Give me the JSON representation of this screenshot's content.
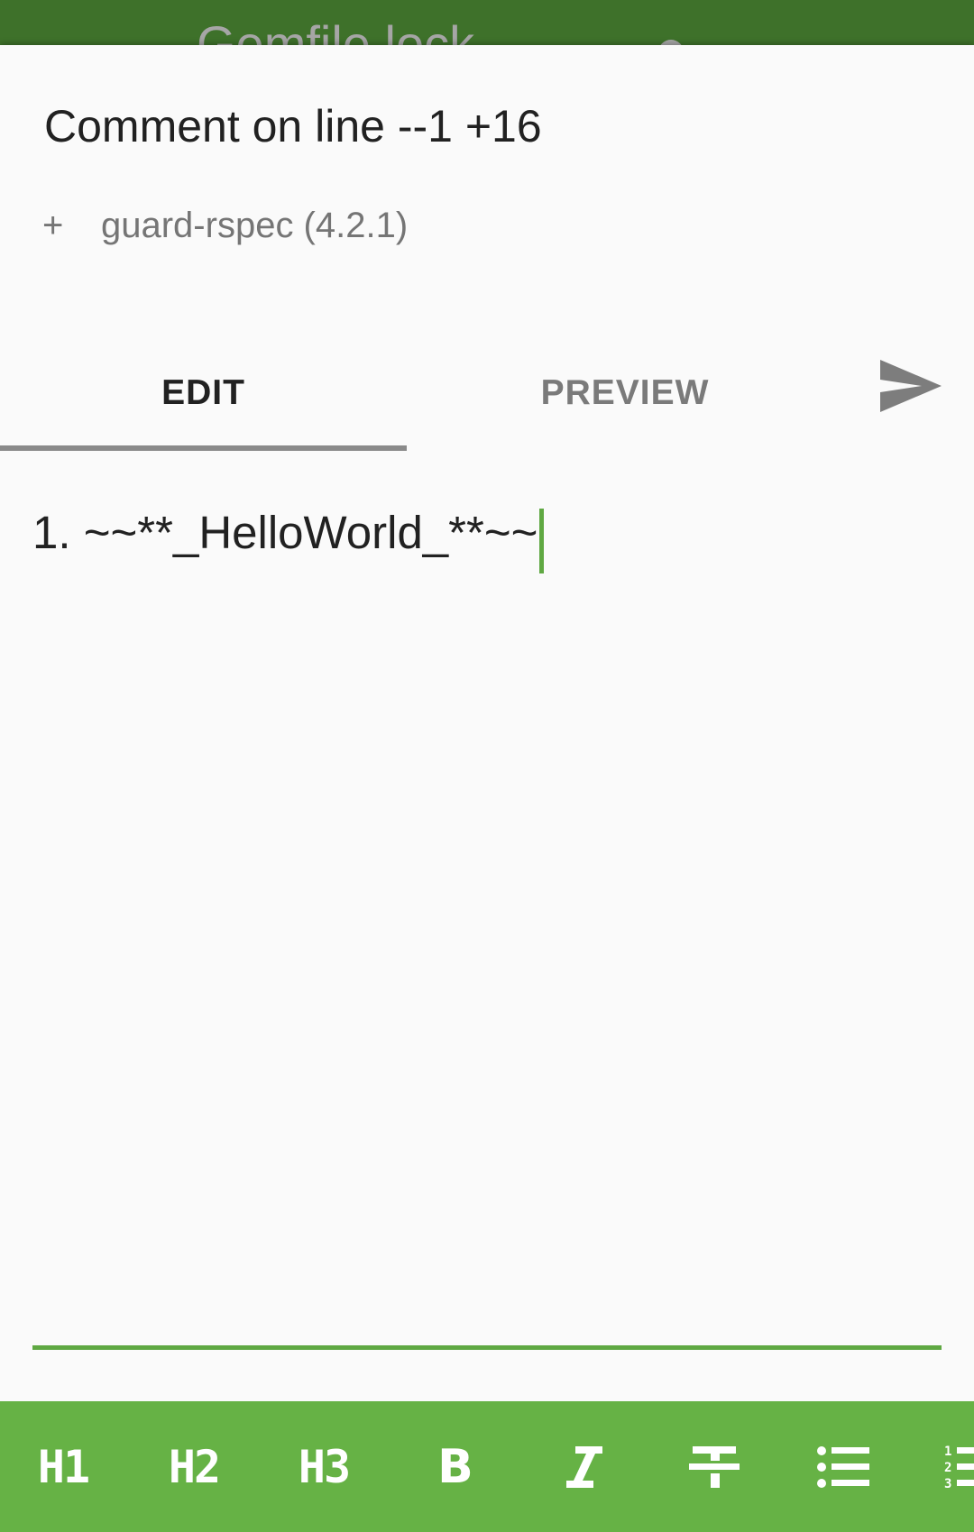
{
  "top_bar": {
    "title": "Gemfile.lock",
    "color": "#3e712a"
  },
  "dialog": {
    "title": "Comment on line --1 +16",
    "diff_marker": "+",
    "diff_text": "guard-rspec (4.2.1)"
  },
  "tabs": [
    {
      "label": "EDIT",
      "selected": true
    },
    {
      "label": "PREVIEW",
      "selected": false
    }
  ],
  "send": {
    "icon": "send-icon"
  },
  "editor": {
    "text": "1. ~~**_HelloWorld_**~~",
    "accent": "#5fa842"
  },
  "toolbar": {
    "background": "#66b245",
    "buttons": [
      {
        "label": "H1",
        "icon": "heading-1-icon"
      },
      {
        "label": "H2",
        "icon": "heading-2-icon"
      },
      {
        "label": "H3",
        "icon": "heading-3-icon"
      },
      {
        "label": "B",
        "icon": "bold-icon"
      },
      {
        "label": "I",
        "icon": "italic-icon"
      },
      {
        "label": "",
        "icon": "strikethrough-icon"
      },
      {
        "label": "",
        "icon": "bulleted-list-icon"
      },
      {
        "label": "",
        "icon": "numbered-list-icon"
      }
    ]
  }
}
